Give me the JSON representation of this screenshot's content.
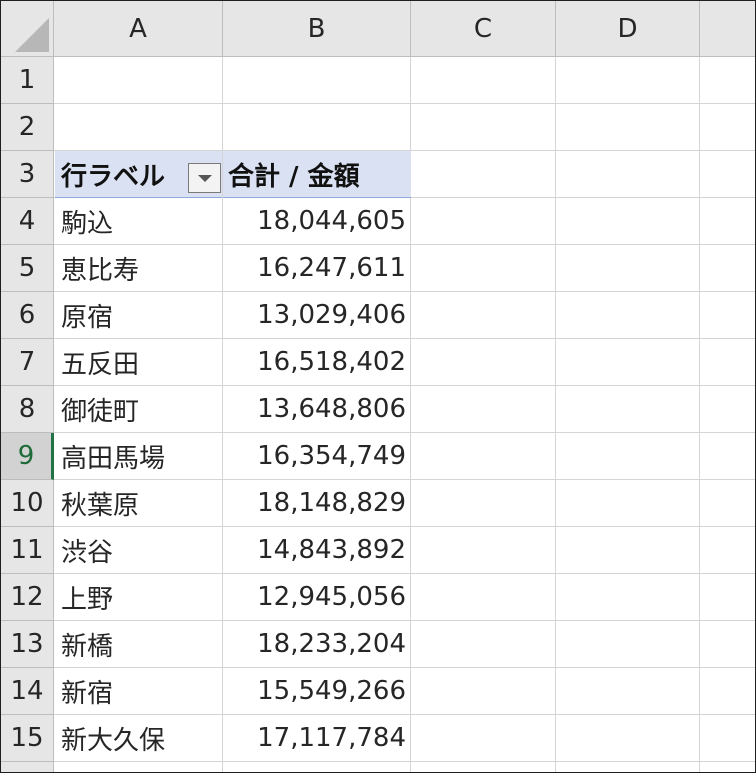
{
  "sheet": {
    "columns": [
      "A",
      "B",
      "C",
      "D"
    ],
    "rows": [
      "1",
      "2",
      "3",
      "4",
      "5",
      "6",
      "7",
      "8",
      "9",
      "10",
      "11",
      "12",
      "13",
      "14",
      "15"
    ],
    "active_row": "9"
  },
  "pivot": {
    "row_label_header": "行ラベル",
    "value_header": "合計 / 金額",
    "items": [
      {
        "label": "駒込",
        "value": "18,044,605"
      },
      {
        "label": "恵比寿",
        "value": "16,247,611"
      },
      {
        "label": "原宿",
        "value": "13,029,406"
      },
      {
        "label": "五反田",
        "value": "16,518,402"
      },
      {
        "label": "御徒町",
        "value": "13,648,806"
      },
      {
        "label": "高田馬場",
        "value": "16,354,749"
      },
      {
        "label": "秋葉原",
        "value": "18,148,829"
      },
      {
        "label": "渋谷",
        "value": "14,843,892"
      },
      {
        "label": "上野",
        "value": "12,945,056"
      },
      {
        "label": "新橋",
        "value": "18,233,204"
      },
      {
        "label": "新宿",
        "value": "15,549,266"
      },
      {
        "label": "新大久保",
        "value": "17,117,784"
      }
    ]
  },
  "colors": {
    "pivot_header_fill": "#d9e1f2",
    "active_row_accent": "#217346"
  }
}
